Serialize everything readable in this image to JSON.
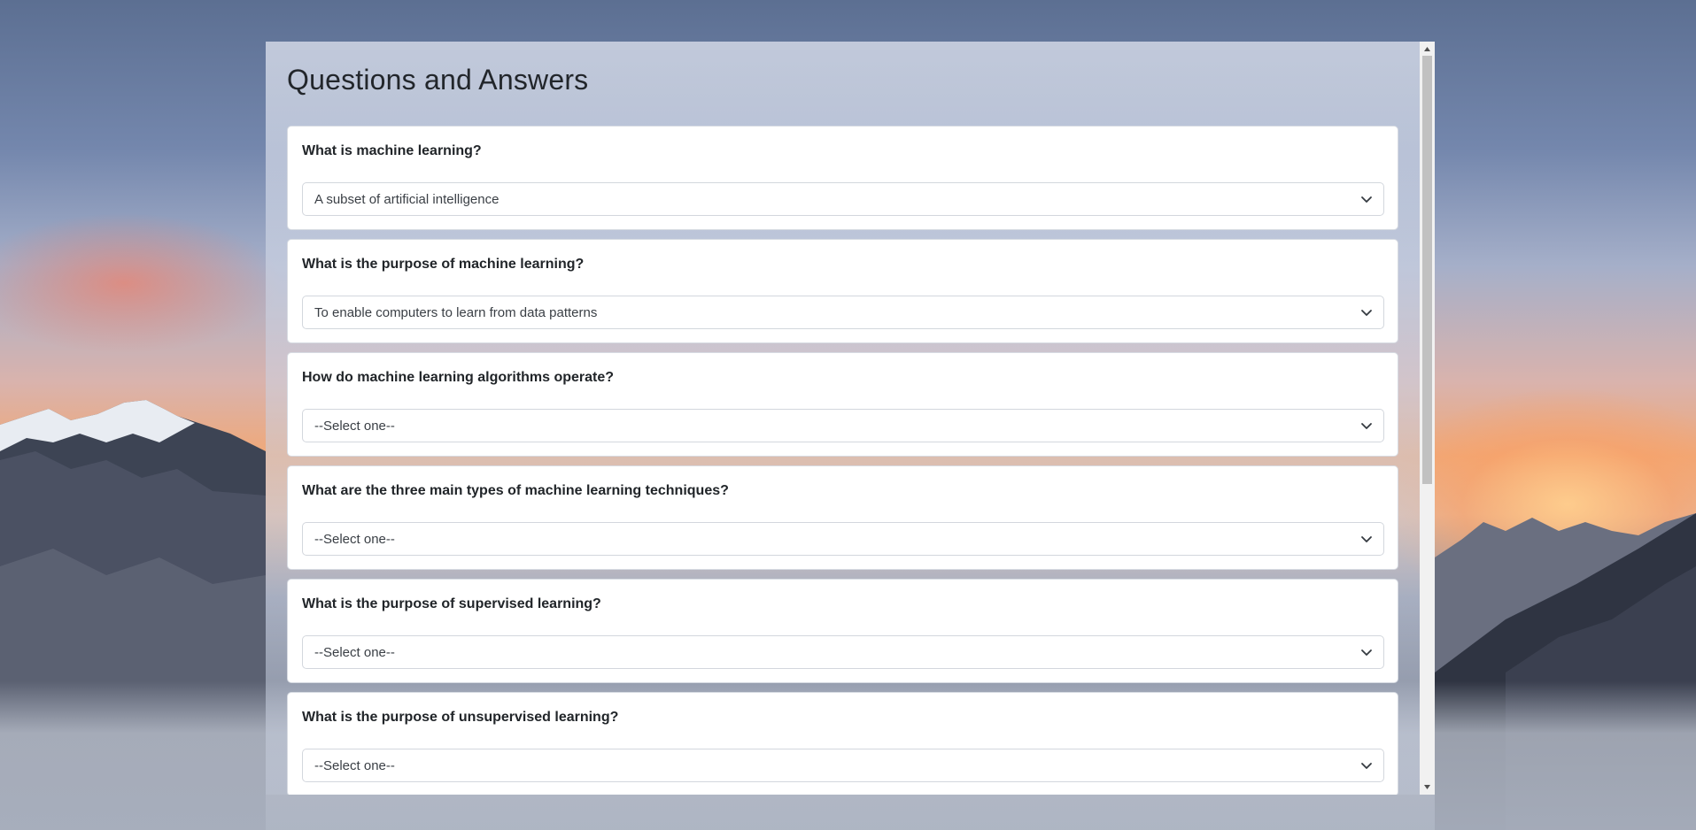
{
  "page": {
    "title": "Questions and Answers"
  },
  "questions": [
    {
      "question": "What is machine learning?",
      "selected": "A subset of artificial intelligence"
    },
    {
      "question": "What is the purpose of machine learning?",
      "selected": "To enable computers to learn from data patterns"
    },
    {
      "question": "How do machine learning algorithms operate?",
      "selected": "--Select one--"
    },
    {
      "question": "What are the three main types of machine learning techniques?",
      "selected": "--Select one--"
    },
    {
      "question": "What is the purpose of supervised learning?",
      "selected": "--Select one--"
    },
    {
      "question": "What is the purpose of unsupervised learning?",
      "selected": "--Select one--"
    }
  ],
  "icons": {
    "chevron": "chevron-down-icon",
    "scroll_up": "scroll-up-arrow-icon",
    "scroll_down": "scroll-down-arrow-icon"
  },
  "colors": {
    "card_bg": "#ffffff",
    "text": "#212529",
    "scrollbar_track": "#f1f1f1",
    "scrollbar_thumb": "#c1c1c1"
  }
}
